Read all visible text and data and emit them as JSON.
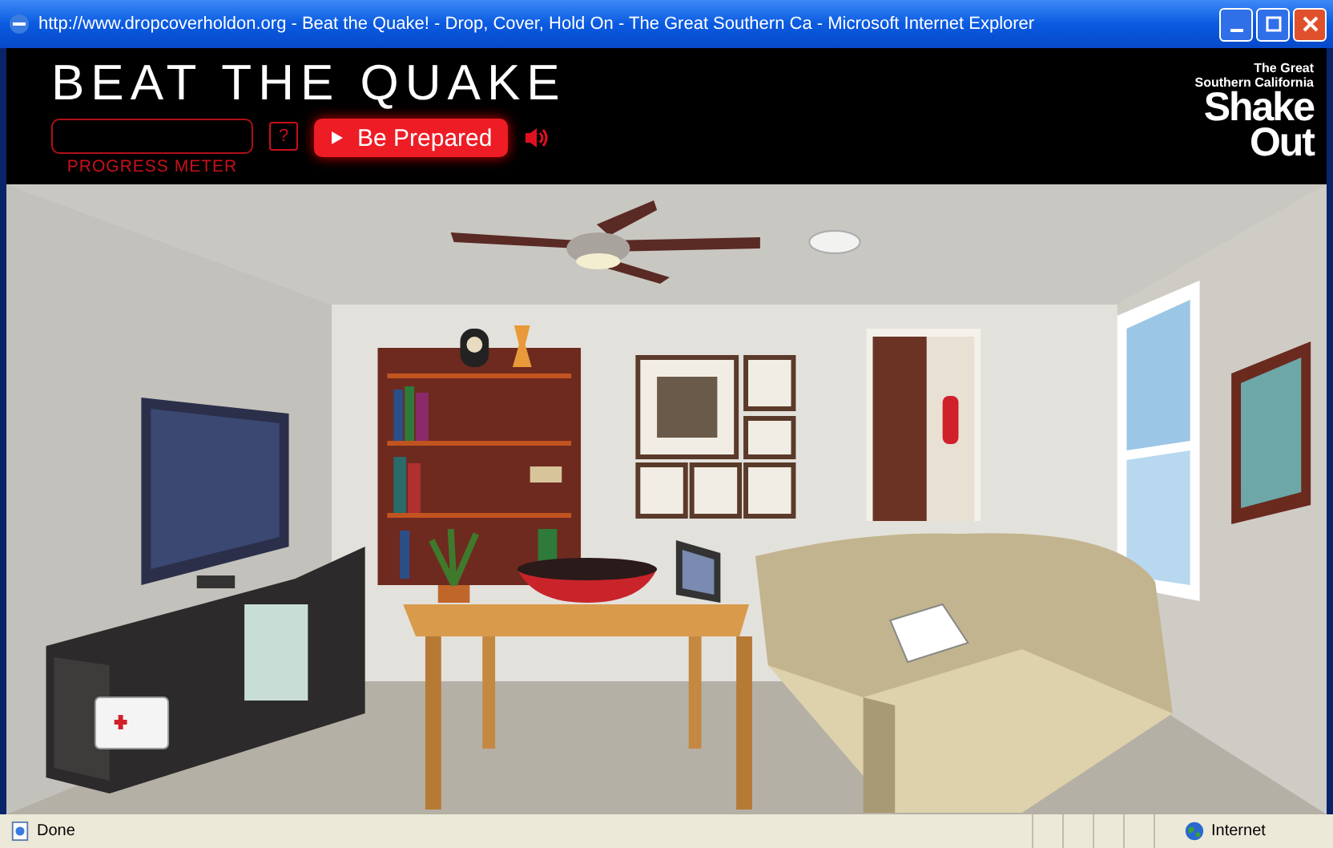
{
  "window": {
    "title": "http://www.dropcoverholdon.org - Beat the Quake! - Drop, Cover, Hold On - The Great Southern Ca - Microsoft Internet Explorer"
  },
  "header": {
    "title": "BEAT THE QUAKE",
    "progress_meter": {
      "label": "PROGRESS METER",
      "level": 0
    },
    "help_button": "?",
    "play_button": "Be Prepared"
  },
  "logo": {
    "line_1": "The Great",
    "line_2": "Southern California",
    "word_1": "Shake",
    "word_2": "Out"
  },
  "status_bar": {
    "status": "Done",
    "zone": "Internet"
  }
}
